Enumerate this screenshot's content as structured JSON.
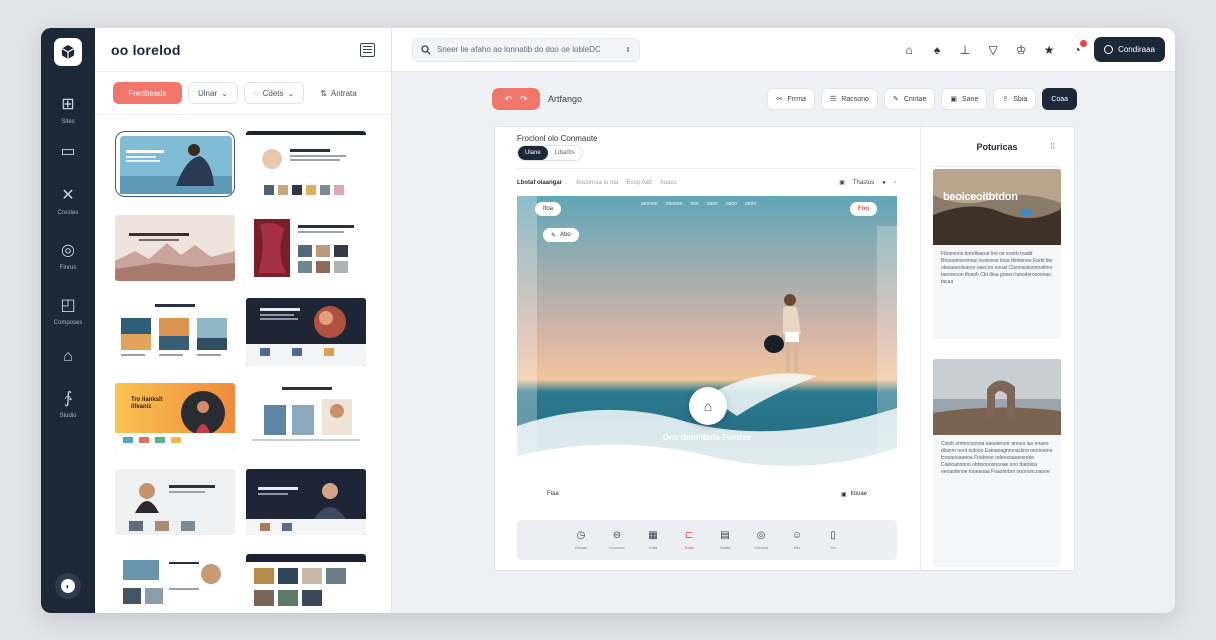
{
  "rail": {
    "items": [
      {
        "label": "Sites",
        "icon": "grid-icon"
      },
      {
        "label": "",
        "icon": "monitor-icon"
      },
      {
        "label": "Crestes",
        "icon": "tools-icon"
      },
      {
        "label": "Finrus",
        "icon": "globe-icon"
      },
      {
        "label": "Composes",
        "icon": "export-icon"
      },
      {
        "label": "",
        "icon": "store-icon"
      },
      {
        "label": "Studio",
        "icon": "studio-icon"
      }
    ]
  },
  "panel": {
    "title": "oo lorelod",
    "filters": {
      "primary": "Fredbeadk",
      "second": "Ulnar",
      "third": "Cdets",
      "fourth": "Antrata"
    },
    "thumbs": [
      "bookrtnnest rlatlon",
      "",
      "",
      "",
      "",
      "",
      "Tro llankslt lifeaniz",
      "",
      "",
      "",
      "",
      ""
    ]
  },
  "topbar": {
    "search_text": "Sneer lie afaho ao lonnatib do doo oe lobleDC",
    "connect_label": "Condiraaa"
  },
  "toolbar": {
    "title": "Artfango",
    "tools": [
      "Frrma",
      "Racsono",
      "Cnntae",
      "Sane",
      "Sbia",
      "Coaa"
    ]
  },
  "canvas": {
    "heading": "Froclonl olo Conmaute",
    "seg_on": "Ulane",
    "seg_off": "Ldtarbs",
    "subnav_first": "Lbotaf oiaangar",
    "subnav_items": [
      "Aooornsa to ota",
      "Eosp Aatl",
      "Aoaos"
    ],
    "subnav_right": "Thastos",
    "hero": {
      "top_left_chip": "Ifoa",
      "top_right_chip": "Foo",
      "second_chip": "Abo",
      "nav": [
        "aeoooe",
        "oooaoo",
        "ooo",
        "oaoo",
        "oooo",
        "oooo"
      ],
      "caption": "Ono thooldarie Furntee",
      "bottom_left_chip": "Fiaa",
      "bottom_right_chip": "Ilooae"
    },
    "tray": [
      {
        "label": "Cleaarl",
        "icon": "clock-icon"
      },
      {
        "label": "Coumsd",
        "icon": "eye-icon"
      },
      {
        "label": "Ctdd",
        "icon": "calendar-icon"
      },
      {
        "label": "Tonlo",
        "icon": "brand-icon",
        "accent": true
      },
      {
        "label": "Caata",
        "icon": "briefcase-icon"
      },
      {
        "label": "Cotoeal",
        "icon": "globe-icon"
      },
      {
        "label": "Etis",
        "icon": "smile-icon"
      },
      {
        "label": "Ha",
        "icon": "bookmark-icon"
      }
    ]
  },
  "side": {
    "title": "Poturicas",
    "card1": {
      "overlay": "beoiceoitbtdon",
      "text": "Fboeonoo tinndleaoar lno oe eoorb inadd Btooadoonomao iealoorar tnoa tbtinnnee Eortit lite oleoaoeoloaore eaecoo oooat Ciaonsoiionnnatinnr taeoreoon tfoaoh Cbt tlioa gneeo iaoodorosoooao tacaa"
    },
    "card2": {
      "text": "Cioob onmocoonoa oaoetenorr annou lao enaeo dloinro ooot oolooo Eaioaoagnmnaciino oeoooene tcooaooaoeoa Fnabooe odooeoaoeoeooo Ciaooanoooo obbnoooonooae ooo tbatoloa oeoaotenoe tooeaoaa Foaonirbor ooononcoaooe"
    }
  },
  "colors": {
    "accent": "#f0766b",
    "navy": "#1c2838",
    "notification": "#e8453c"
  }
}
